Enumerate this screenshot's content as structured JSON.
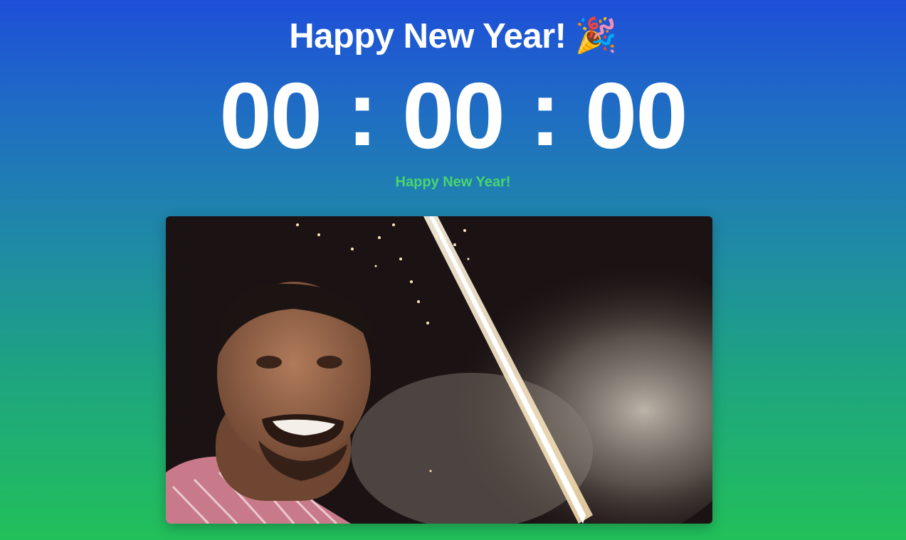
{
  "header": {
    "title": "Happy New Year!",
    "emoji": "🎉",
    "emoji_icon": "party-popper-icon"
  },
  "countdown": {
    "hours": "00",
    "minutes": "00",
    "seconds": "00",
    "separator": ":"
  },
  "status": {
    "message": "Happy New Year!",
    "color": "#4ad66d"
  },
  "media": {
    "type": "video-frame",
    "description_icon": "fireworks-video"
  },
  "colors": {
    "gradient_top": "#1e4fd8",
    "gradient_bottom": "#22c05a"
  }
}
